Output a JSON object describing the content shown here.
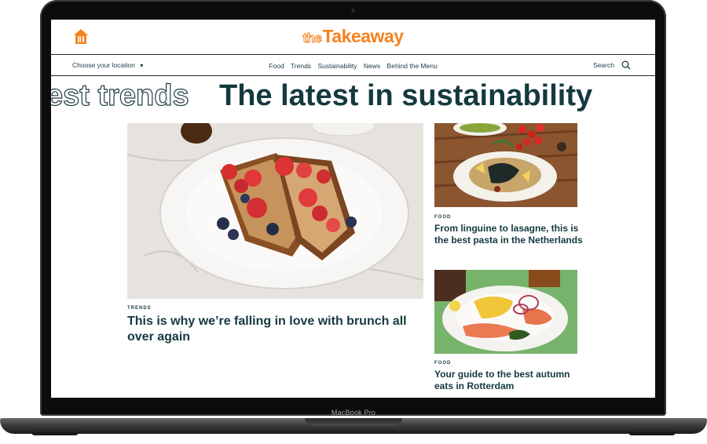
{
  "device": {
    "bezel_label": "MacBook Pro"
  },
  "header": {
    "brand_prefix": "the",
    "brand_name": "Takeaway",
    "brand_color": "#f5821f",
    "logo_icon": "house-fork-icon"
  },
  "nav": {
    "location_label": "Choose your location",
    "links": [
      "Food",
      "Trends",
      "Sustainability",
      "News",
      "Behind the Menu"
    ],
    "search_label": "Search"
  },
  "marquee": {
    "outline_text": "est trends",
    "solid_text": "The latest in sustainability"
  },
  "articles": {
    "main": {
      "category": "TRENDS",
      "title": "This is why we’re falling in love with brunch all over again"
    },
    "side1": {
      "category": "FOOD",
      "title": "From linguine to lasagne, this is the best pasta in the Netherlands"
    },
    "side2": {
      "category": "FOOD",
      "title": "Your guide to the best autumn eats in Rotterdam"
    }
  },
  "colors": {
    "text_dark": "#14393f",
    "accent": "#f5821f"
  }
}
